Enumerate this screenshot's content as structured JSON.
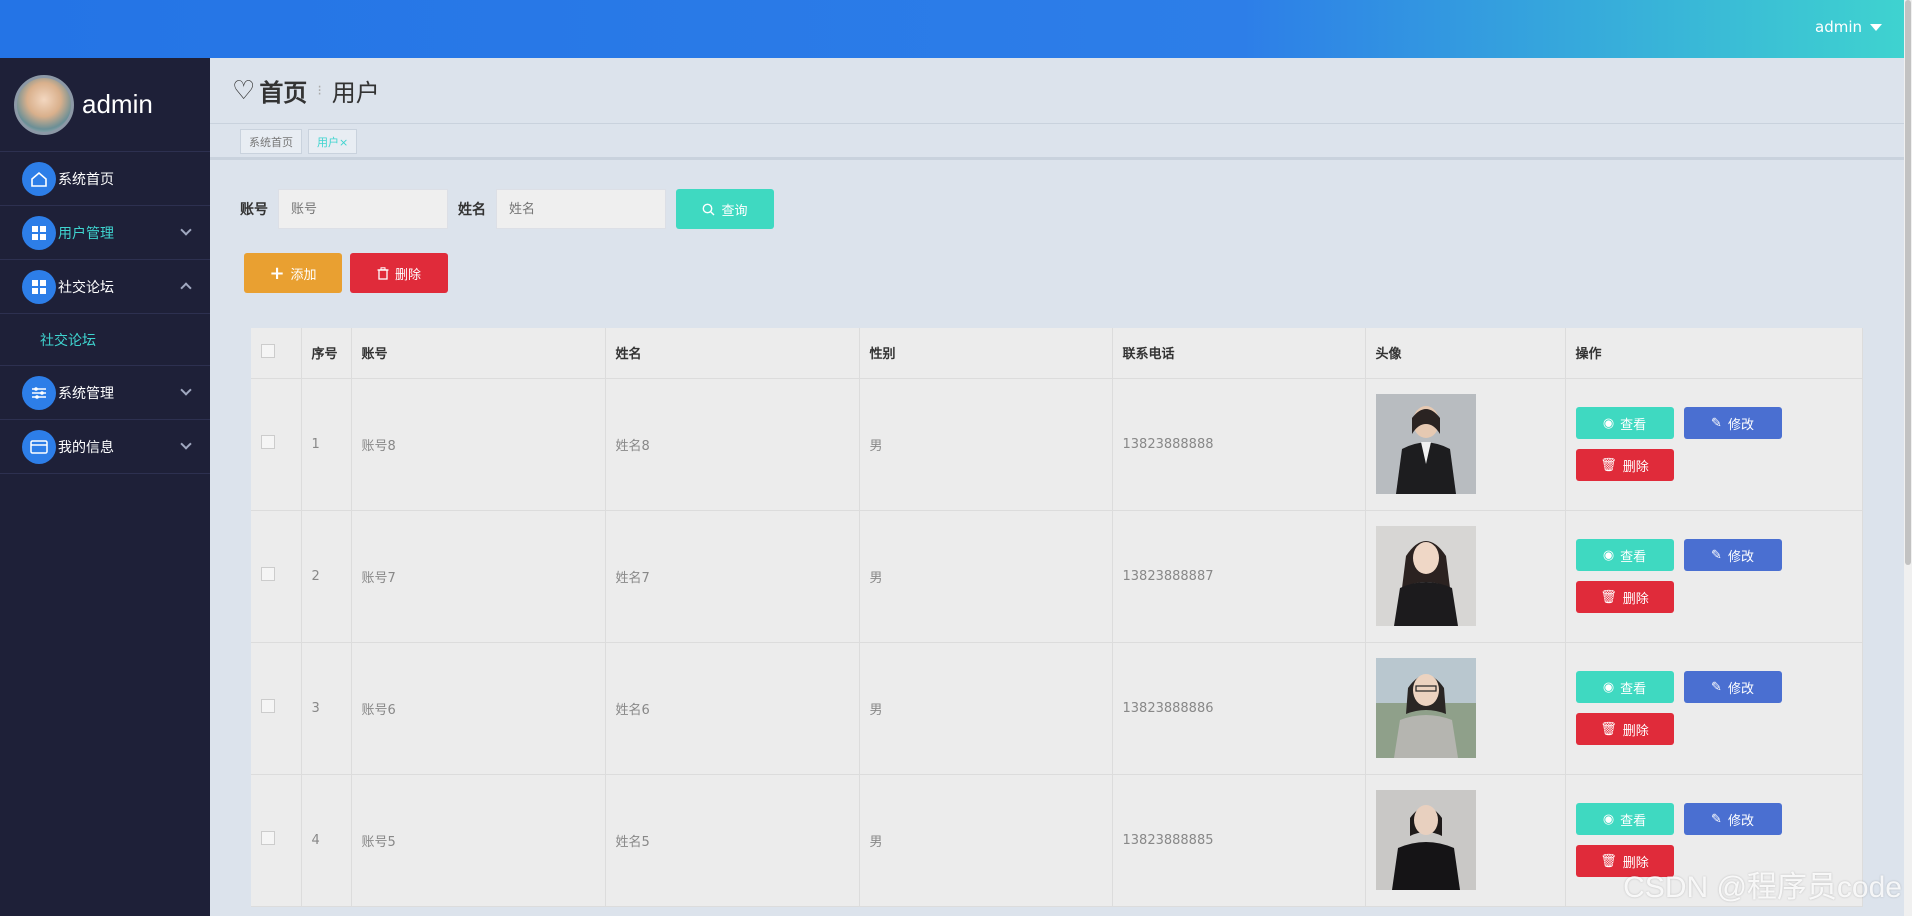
{
  "topbar": {
    "user": "admin"
  },
  "sidebar": {
    "profile_name": "admin",
    "items": [
      {
        "label": "系统首页"
      },
      {
        "label": "用户管理"
      },
      {
        "label": "社交论坛"
      },
      {
        "label": "社交论坛"
      },
      {
        "label": "系统管理"
      },
      {
        "label": "我的信息"
      }
    ]
  },
  "header": {
    "home": "首页",
    "current": "用户"
  },
  "tags": [
    {
      "label": "系统首页"
    },
    {
      "label": "用户×"
    }
  ],
  "search": {
    "account_label": "账号",
    "account_placeholder": "账号",
    "name_label": "姓名",
    "name_placeholder": "姓名",
    "query_label": "查询"
  },
  "toolbar": {
    "add_label": "添加",
    "delete_label": "删除"
  },
  "table": {
    "headers": [
      "序号",
      "账号",
      "姓名",
      "性别",
      "联系电话",
      "头像",
      "操作"
    ],
    "rows": [
      {
        "no": "1",
        "account": "账号8",
        "name": "姓名8",
        "gender": "男",
        "phone": "13823888888"
      },
      {
        "no": "2",
        "account": "账号7",
        "name": "姓名7",
        "gender": "男",
        "phone": "13823888887"
      },
      {
        "no": "3",
        "account": "账号6",
        "name": "姓名6",
        "gender": "男",
        "phone": "13823888886"
      },
      {
        "no": "4",
        "account": "账号5",
        "name": "姓名5",
        "gender": "男",
        "phone": "13823888885"
      }
    ],
    "ops": {
      "view": "查看",
      "edit": "修改",
      "delete": "删除"
    }
  },
  "watermark": "CSDN @程序员code",
  "colors": {
    "accent": "#3fd9c1",
    "primary": "#2d7ee8",
    "danger": "#e02b3a",
    "warning": "#e9a031",
    "edit": "#4a6fd1",
    "sidebar_bg": "#1e2038"
  }
}
